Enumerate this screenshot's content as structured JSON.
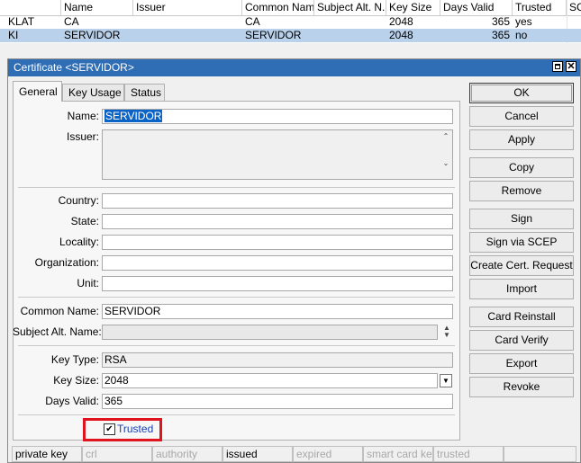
{
  "table": {
    "headers": [
      "",
      "Name",
      "Issuer",
      "Common Name",
      "Subject Alt. N...",
      "Key Size",
      "Days Valid",
      "Trusted",
      "SC"
    ],
    "rows": [
      {
        "flags": "KLAT",
        "name": "CA",
        "issuer": "",
        "common_name": "CA",
        "subject_alt": "",
        "key_size": "2048",
        "days_valid": "365",
        "trusted": "yes",
        "selected": false
      },
      {
        "flags": "KI",
        "name": "SERVIDOR",
        "issuer": "",
        "common_name": "SERVIDOR",
        "subject_alt": "",
        "key_size": "2048",
        "days_valid": "365",
        "trusted": "no",
        "selected": true
      }
    ]
  },
  "dialog": {
    "title": "Certificate <SERVIDOR>",
    "tabs": [
      {
        "label": "General",
        "active": true
      },
      {
        "label": "Key Usage",
        "active": false
      },
      {
        "label": "Status",
        "active": false
      }
    ],
    "fields": {
      "name": {
        "label": "Name:",
        "value": "SERVIDOR"
      },
      "issuer": {
        "label": "Issuer:",
        "value": ""
      },
      "country": {
        "label": "Country:",
        "value": ""
      },
      "state": {
        "label": "State:",
        "value": ""
      },
      "locality": {
        "label": "Locality:",
        "value": ""
      },
      "organization": {
        "label": "Organization:",
        "value": ""
      },
      "unit": {
        "label": "Unit:",
        "value": ""
      },
      "common_name": {
        "label": "Common Name:",
        "value": "SERVIDOR"
      },
      "subject_alt_name": {
        "label": "Subject Alt. Name:",
        "value": ""
      },
      "key_type": {
        "label": "Key Type:",
        "value": "RSA"
      },
      "key_size": {
        "label": "Key Size:",
        "value": "2048"
      },
      "days_valid": {
        "label": "Days Valid:",
        "value": "365"
      }
    },
    "trusted": {
      "label": "Trusted",
      "checked": true
    },
    "buttons": [
      "OK",
      "Cancel",
      "Apply",
      "Copy",
      "Remove",
      "Sign",
      "Sign via SCEP",
      "Create Cert. Request",
      "Import",
      "Card Reinstall",
      "Card Verify",
      "Export",
      "Revoke"
    ],
    "status": [
      {
        "label": "private key",
        "enabled": true
      },
      {
        "label": "crl",
        "enabled": false
      },
      {
        "label": "authority",
        "enabled": false
      },
      {
        "label": "issued",
        "enabled": true
      },
      {
        "label": "expired",
        "enabled": false
      },
      {
        "label": "smart card key",
        "enabled": false
      },
      {
        "label": "trusted",
        "enabled": false
      },
      {
        "label": "",
        "enabled": false
      }
    ]
  },
  "colors": {
    "titlebar": "#2f6db5",
    "selection": "#b9d1ea",
    "highlight_box": "#e0141e",
    "link_text": "#1a3fb0"
  },
  "icons": {
    "maximize": "maximize-icon",
    "close": "close-icon",
    "checkbox": "checkmark-icon",
    "dropdown": "dropdown-arrow-icon",
    "updown": "up-down-arrows-icon",
    "scroll": "scroll-arrows-icon"
  }
}
